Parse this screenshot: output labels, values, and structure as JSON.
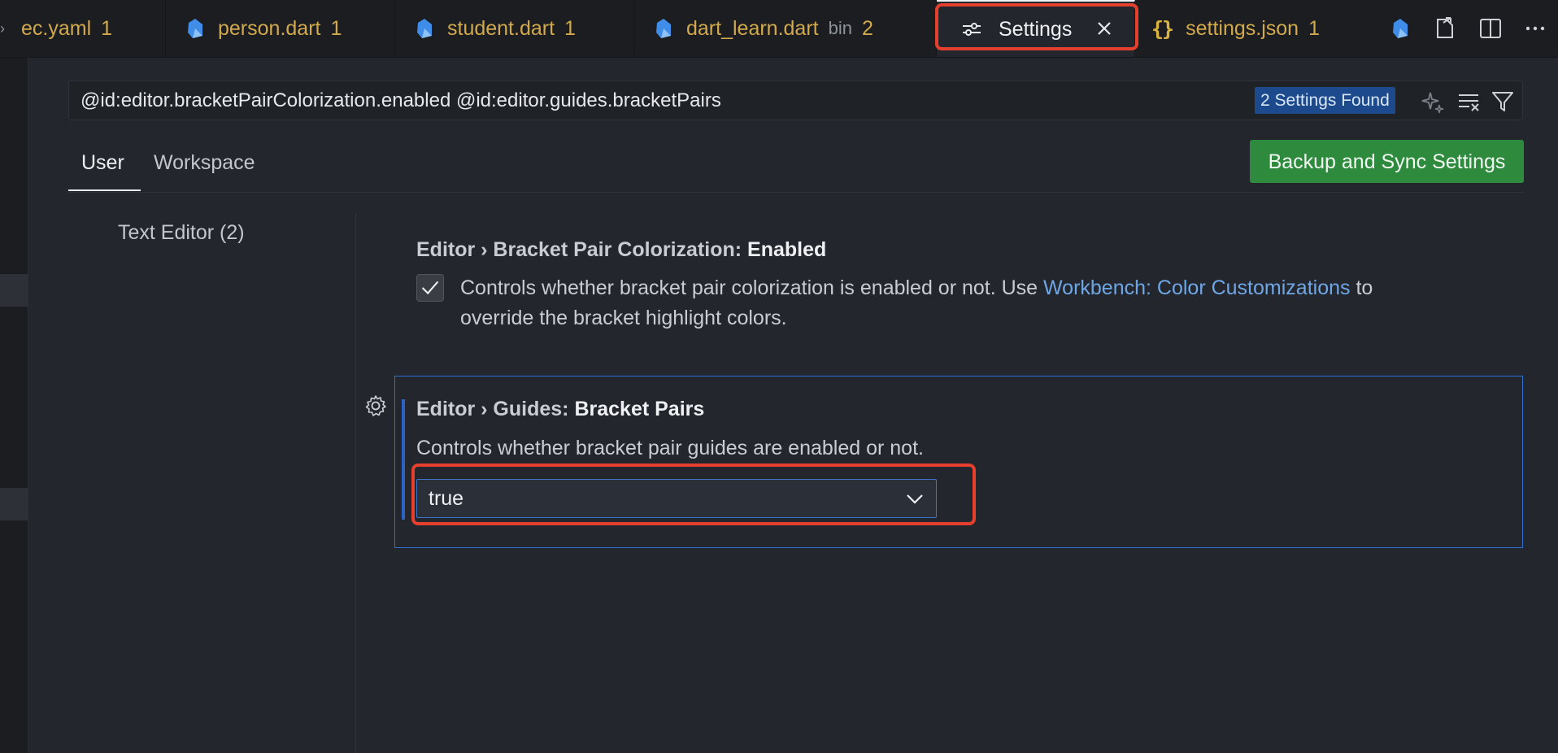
{
  "tabs": [
    {
      "label": "ec.yaml",
      "count": "1"
    },
    {
      "label": "person.dart",
      "count": "1"
    },
    {
      "label": "student.dart",
      "count": "1"
    },
    {
      "label": "dart_learn.dart",
      "badge": "bin",
      "count": "2"
    },
    {
      "label": "Settings"
    },
    {
      "label": "settings.json",
      "count": "1"
    }
  ],
  "search": {
    "query": "@id:editor.bracketPairColorization.enabled @id:editor.guides.bracketPairs",
    "result_badge": "2 Settings Found"
  },
  "scope_tabs": [
    "User",
    "Workspace"
  ],
  "sync_button": "Backup and Sync Settings",
  "toc": {
    "item": "Text Editor (2)"
  },
  "setting1": {
    "category": "Editor › Bracket Pair Colorization: ",
    "name": "Enabled",
    "checked": true,
    "desc_before": "Controls whether bracket pair colorization is enabled or not. Use ",
    "link": "Workbench: Color Customizations",
    "desc_after": " to",
    "desc_line2": "override the bracket highlight colors."
  },
  "setting2": {
    "category": "Editor › Guides: ",
    "name": "Bracket Pairs",
    "desc": "Controls whether bracket pair guides are enabled or not.",
    "value": "true"
  },
  "colors": {
    "accent_link": "#6fa7e6",
    "sync_button": "#2e8a3c",
    "highlight_box": "#e5402d",
    "focus_border": "#2f6fd1"
  }
}
